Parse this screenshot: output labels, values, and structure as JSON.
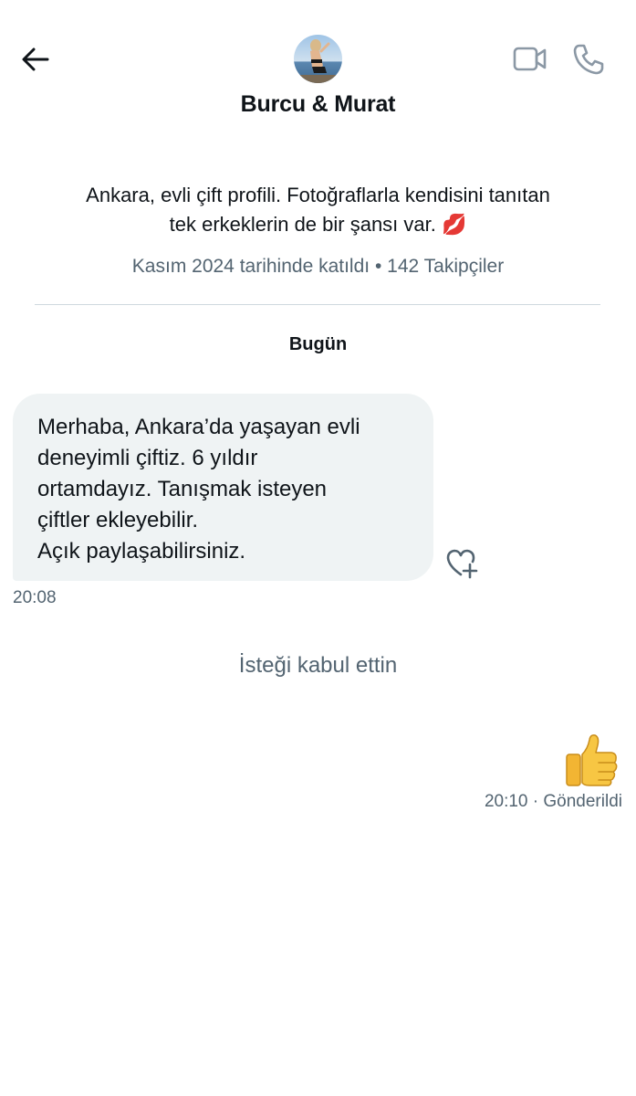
{
  "header": {
    "name": "Burcu & Murat",
    "back_icon": "arrow-left-icon",
    "video_icon": "video-camera-icon",
    "call_icon": "phone-icon"
  },
  "profile": {
    "bio_line1": "Ankara, evli çift profili. Fotoğraflarla kendisini tanıtan",
    "bio_line2": "tek erkeklerin de bir şansı var. 💋",
    "joined": "Kasım 2024 tarihinde katıldı",
    "separator": "•",
    "followers": "142 Takipçiler"
  },
  "chat": {
    "day_label": "Bugün",
    "incoming": {
      "lines": [
        "Merhaba, Ankara’da yaşayan evli",
        "deneyimli çiftiz. 6 yıldır",
        "ortamdayız. Tanışmak isteyen",
        "çiftler ekleyebilir.",
        "Açık paylaşabilirsiniz."
      ],
      "time": "20:08",
      "reaction_icon": "heart-plus-icon"
    },
    "system_message": "İsteği kabul ettin",
    "outgoing": {
      "content": "👍",
      "time": "20:10",
      "status": "· Gönderildi"
    }
  },
  "colors": {
    "text": "#0f1419",
    "secondary": "#536471",
    "bubble": "#eff3f4",
    "divider": "#cfd9de"
  }
}
